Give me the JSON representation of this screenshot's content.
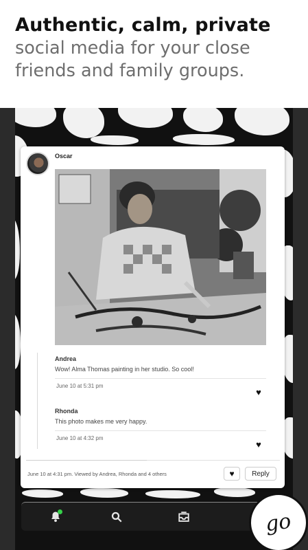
{
  "headline": {
    "title": "Authentic, calm, private",
    "line2": "social media for your close",
    "line3": "friends and family groups."
  },
  "post": {
    "author": "Oscar",
    "comments": [
      {
        "name": "Andrea",
        "text": "Wow! Alma Thomas painting in her studio. So cool!",
        "time": "June 10 at 5:31 pm"
      },
      {
        "name": "Rhonda",
        "text": "This photo makes me very happy.",
        "time": "June 10 at 4:32 pm"
      }
    ],
    "footer": {
      "meta": "June 10 at 4:31 pm. Viewed by Andrea, Rhonda and 4 others",
      "reply_label": "Reply"
    }
  },
  "icons": {
    "heart": "♥",
    "bell": "bell-icon",
    "search": "search-icon",
    "inbox": "inbox-icon"
  },
  "badge": {
    "text": "go"
  },
  "colors": {
    "notification": "#36d24a"
  }
}
